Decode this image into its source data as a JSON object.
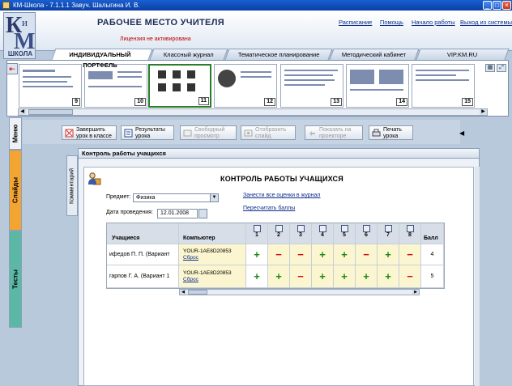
{
  "window": {
    "title": "КМ-Школа - 7.1.1.1 Завуч. Шалыгина И. В.",
    "buttons": [
      "_",
      "□",
      "×"
    ]
  },
  "logo": {
    "k": "К",
    "i": "и",
    "m": "М",
    "school": "ШКОЛА"
  },
  "header": {
    "title": "РАБОЧЕЕ МЕСТО УЧИТЕЛЯ",
    "license": "Лицензия не активирована",
    "links": [
      "Расписание",
      "Помощь",
      "Начало работы",
      "Выход из системы"
    ]
  },
  "tabs": [
    {
      "label": "ИНДИВИДУАЛЬНЫЙ ПОРТФЕЛЬ",
      "active": true
    },
    {
      "label": "Классный журнал",
      "active": false
    },
    {
      "label": "Тематическое планирование",
      "active": false
    },
    {
      "label": "Методический кабинет",
      "active": false
    },
    {
      "label": "VIP.KM.RU",
      "active": false
    }
  ],
  "slides": [
    {
      "num": "9"
    },
    {
      "num": "10"
    },
    {
      "num": "11",
      "active": true
    },
    {
      "num": "12"
    },
    {
      "num": "13"
    },
    {
      "num": "14"
    },
    {
      "num": "15"
    }
  ],
  "sidetabs": {
    "menu": "Меню",
    "slides": "Слайды",
    "tests": "Тесты"
  },
  "toolbar": {
    "finish": "Завершить урок в классе",
    "results": "Результаты урока",
    "free_view": "Свободный просмотр",
    "show_slide": "Отобразить слайд",
    "projector": "Показать на проекторе",
    "print": "Печать урока"
  },
  "comment_tab": "Комментарий",
  "panel": {
    "header": "Контроль работы учащихся",
    "title": "КОНТРОЛЬ РАБОТЫ УЧАЩИХСЯ",
    "subject_label": "Предмет:",
    "subject_value": "Физика",
    "date_label": "Дата проведения:",
    "date_value": "12.01.2008",
    "link_journal": "Занести все оценки в журнал",
    "link_recalc": "Пересчитать баллы"
  },
  "grid": {
    "col_student": "Учащиеся",
    "col_computer": "Компьютер",
    "col_score": "Балл",
    "questions": [
      "1",
      "2",
      "3",
      "4",
      "5",
      "6",
      "7",
      "8"
    ],
    "rows": [
      {
        "student": "ифедов П. П. (Вариант",
        "computer": "YOUR-1AE8D20853",
        "reset": "Сброс",
        "marks": [
          "+",
          "−",
          "−",
          "+",
          "+",
          "−",
          "+",
          "−"
        ],
        "score": "4"
      },
      {
        "student": "гарпов Г. А. (Вариант 1",
        "computer": "YOUR-1AE8D20853",
        "reset": "Сброс",
        "marks": [
          "+",
          "+",
          "−",
          "+",
          "+",
          "+",
          "+",
          "−"
        ],
        "score": "5"
      }
    ]
  }
}
